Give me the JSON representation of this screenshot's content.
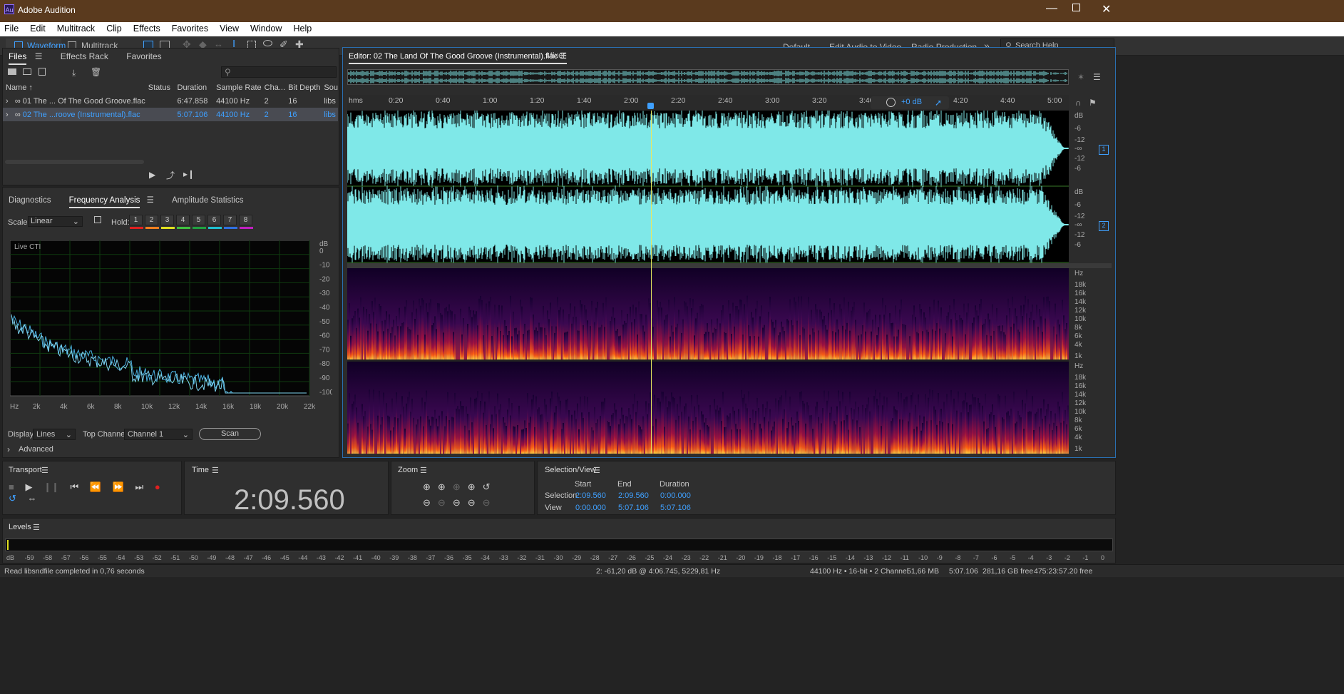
{
  "app": {
    "title": "Adobe Audition",
    "logo": "Au"
  },
  "menu": [
    "File",
    "Edit",
    "Multitrack",
    "Clip",
    "Effects",
    "Favorites",
    "View",
    "Window",
    "Help"
  ],
  "toolbar": {
    "waveform": "Waveform",
    "multitrack": "Multitrack",
    "workspaces": [
      "Default",
      "Edit Audio to Video",
      "Radio Production"
    ],
    "search_placeholder": "Search Help"
  },
  "files_panel": {
    "tabs": [
      "Files",
      "Effects Rack",
      "Favorites"
    ],
    "columns": [
      "Name",
      "Status",
      "Duration",
      "Sample Rate",
      "Cha...",
      "Bit Depth",
      "Sou"
    ],
    "rows": [
      {
        "name": "01 The ... Of The Good Groove.flac",
        "status": "",
        "duration": "6:47.858",
        "rate": "44100 Hz",
        "ch": "2",
        "bits": "16",
        "src": "libs"
      },
      {
        "name": "02 The ...roove (Instrumental).flac",
        "status": "",
        "duration": "5:07.106",
        "rate": "44100 Hz",
        "ch": "2",
        "bits": "16",
        "src": "libs"
      }
    ]
  },
  "freq_panel": {
    "tabs": [
      "Diagnostics",
      "Frequency Analysis",
      "Amplitude Statistics"
    ],
    "scale_label": "Scale:",
    "scale_value": "Linear",
    "hold_label": "Hold:",
    "holds": [
      "1",
      "2",
      "3",
      "4",
      "5",
      "6",
      "7",
      "8"
    ],
    "hold_colors": [
      "#e02020",
      "#f08020",
      "#e0e020",
      "#40c040",
      "#20a040",
      "#20c0d0",
      "#3070e0",
      "#c020c0"
    ],
    "live": "Live CTI",
    "db_labels": [
      "dB",
      "0",
      "-10",
      "-20",
      "-30",
      "-40",
      "-50",
      "-60",
      "-70",
      "-80",
      "-90",
      "-100"
    ],
    "hz_labels": [
      "Hz",
      "2k",
      "4k",
      "6k",
      "8k",
      "10k",
      "12k",
      "14k",
      "16k",
      "18k",
      "20k",
      "22k"
    ],
    "display_label": "Display:",
    "display_value": "Lines",
    "top_channel_label": "Top Channel:",
    "top_channel_value": "Channel 1",
    "scan": "Scan",
    "advanced": "Advanced"
  },
  "editor": {
    "tab": "Editor: 02 The Land Of The Good Groove (Instrumental).flac",
    "mixer": "Mixer",
    "time_labels": [
      "hms",
      "0:20",
      "0:40",
      "1:00",
      "1:20",
      "1:40",
      "2:00",
      "2:20",
      "2:40",
      "3:00",
      "3:20",
      "3:40",
      "4:20",
      "4:40",
      "5:00"
    ],
    "gain": "+0 dB",
    "db_scale": [
      "dB",
      "-6",
      "-12",
      "-∞",
      "-12",
      "-6"
    ],
    "channels": [
      "1",
      "2"
    ],
    "hz_scale": [
      "Hz",
      "18k",
      "16k",
      "14k",
      "12k",
      "10k",
      "8k",
      "6k",
      "4k",
      "1k"
    ]
  },
  "transport": {
    "title": "Transport"
  },
  "time": {
    "title": "Time",
    "value": "2:09.560"
  },
  "zoom": {
    "title": "Zoom"
  },
  "selection": {
    "title": "Selection/View",
    "headers": [
      "Start",
      "End",
      "Duration"
    ],
    "sel_label": "Selection",
    "view_label": "View",
    "sel": [
      "2:09.560",
      "2:09.560",
      "0:00.000"
    ],
    "view": [
      "0:00.000",
      "5:07.106",
      "5:07.106"
    ]
  },
  "levels": {
    "title": "Levels",
    "ticks": [
      "dB",
      "-59",
      "-58",
      "-57",
      "-56",
      "-55",
      "-54",
      "-53",
      "-52",
      "-51",
      "-50",
      "-49",
      "-48",
      "-47",
      "-46",
      "-45",
      "-44",
      "-43",
      "-42",
      "-41",
      "-40",
      "-39",
      "-38",
      "-37",
      "-36",
      "-35",
      "-34",
      "-33",
      "-32",
      "-31",
      "-30",
      "-29",
      "-28",
      "-27",
      "-26",
      "-25",
      "-24",
      "-23",
      "-22",
      "-21",
      "-20",
      "-19",
      "-18",
      "-17",
      "-16",
      "-15",
      "-14",
      "-13",
      "-12",
      "-11",
      "-10",
      "-9",
      "-8",
      "-7",
      "-6",
      "-5",
      "-4",
      "-3",
      "-2",
      "-1",
      "0"
    ]
  },
  "status": {
    "left": "Read libsndfile completed in 0,76 seconds",
    "cursor": "2: -61,20 dB @ 4:06.745, 5229,81 Hz",
    "format": "44100 Hz • 16-bit • 2 Channel",
    "size": "51,66 MB",
    "duration": "5:07.106",
    "free": "281,16 GB free",
    "timecode": "475:23:57.20 free"
  }
}
